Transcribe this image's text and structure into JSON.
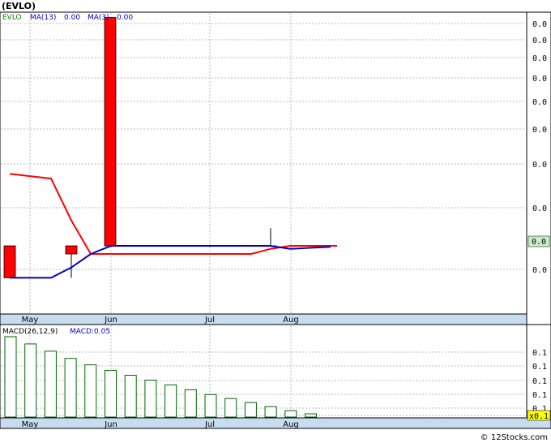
{
  "header": {
    "ticker": "(EVLO)",
    "ticker_label": "EVLO",
    "ma13_label": "MA(13)",
    "ma13_value": "0.00",
    "ma3_label": "MA(3)",
    "ma3_value": "0.00"
  },
  "macd_header": {
    "label": "MACD(26,12,9)",
    "macd_label": "MACD:0.05"
  },
  "footer": {
    "credit": "© 12Stocks.com"
  },
  "colors": {
    "candle": "#ff0000",
    "ma13": "#ff0000",
    "ma3": "#0000cc",
    "grid": "#bbbbbb",
    "axis_band": "#c8dcf0",
    "histogram": "#006600",
    "price_tag": "#c8f0c8",
    "macd_tag": "#ffff00"
  },
  "chart_data": [
    {
      "type": "candlestick",
      "months": [
        "May",
        "Jun",
        "Jul",
        "Aug"
      ],
      "y_axis_labels": [
        "0.0",
        "0.0",
        "0.0",
        "0.0",
        "0.0",
        "0.0",
        "0.0",
        "0.0",
        "0.0"
      ],
      "last_price_label": "0.0",
      "candles": [
        {
          "open": 0.72,
          "close": 1.0,
          "high": 1.0,
          "low": 0.72
        },
        {
          "open": 0.92,
          "close": 1.0,
          "high": 1.0,
          "low": 0.72
        },
        {
          "open": 1.0,
          "close": 10.5,
          "high": 10.5,
          "low": 1.0
        },
        {
          "open": 1.0,
          "close": 1.0,
          "high": 1.0,
          "low": 1.0
        },
        {
          "open": 1.0,
          "close": 1.0,
          "high": 1.2,
          "low": 1.0
        }
      ],
      "ma13": [
        2.1,
        2.0,
        1.3,
        0.92,
        0.92,
        0.92,
        0.92,
        0.92,
        0.97,
        1.0,
        1.0,
        1.0
      ],
      "ma3": [
        0.72,
        0.72,
        0.8,
        0.92,
        1.0,
        1.0,
        1.0,
        1.0,
        1.0,
        0.97,
        0.98,
        0.99
      ]
    },
    {
      "type": "bar",
      "y_axis_labels": [
        "0.1",
        "0.1",
        "0.1",
        "0.1",
        "0.1",
        "0.1"
      ],
      "macd_tag": "x0.1",
      "histogram": [
        0.1,
        0.091,
        0.082,
        0.073,
        0.065,
        0.058,
        0.052,
        0.046,
        0.04,
        0.034,
        0.028,
        0.023,
        0.018,
        0.013,
        0.008,
        0.004
      ]
    }
  ]
}
